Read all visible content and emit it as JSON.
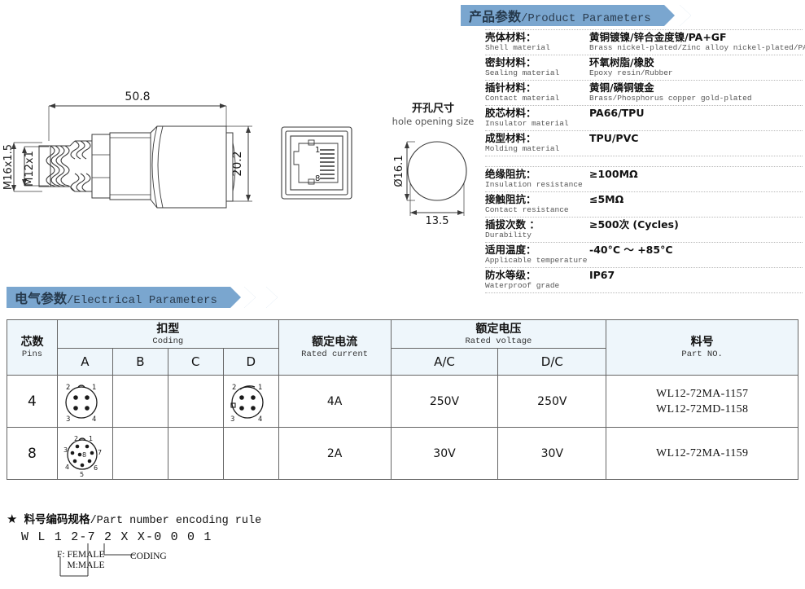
{
  "sections": {
    "product_parameters": {
      "title_cn": "产品参数",
      "title_sep": "/",
      "title_en": "Product Parameters"
    },
    "electrical_parameters": {
      "title_cn": "电气参数",
      "title_sep": "/",
      "title_en": "Electrical Parameters"
    }
  },
  "product_specs": [
    {
      "label_cn": "壳体材料：",
      "label_en": "Shell material",
      "value_cn": "黄铜镀镍/锌合金度镍/PA+GF",
      "value_en": "Brass nickel-plated/Zinc alloy nickel-plated/PA-GF"
    },
    {
      "label_cn": "密封材料：",
      "label_en": "Sealing material",
      "value_cn": "环氧树脂/橡胶",
      "value_en": "Epoxy resin/Rubber"
    },
    {
      "label_cn": "插针材料：",
      "label_en": "Contact material",
      "value_cn": "黄铜/磷铜镀金",
      "value_en": "Brass/Phosphorus copper gold-plated"
    },
    {
      "label_cn": "胶芯材料：",
      "label_en": "Insulator material",
      "value_cn": "PA66/TPU",
      "value_en": ""
    },
    {
      "label_cn": "成型材料：",
      "label_en": "Molding material",
      "value_cn": "TPU/PVC",
      "value_en": ""
    }
  ],
  "product_specs_2": [
    {
      "label_cn": "绝缘阻抗：",
      "label_en": "Insulation resistance",
      "value_cn": "≥100MΩ",
      "value_en": ""
    },
    {
      "label_cn": "接触阻抗：",
      "label_en": "Contact resistance",
      "value_cn": "≤5MΩ",
      "value_en": ""
    },
    {
      "label_cn": "插拔次数 ：",
      "label_en": "Durability",
      "value_cn": "≥500次 (Cycles)",
      "value_en": ""
    },
    {
      "label_cn": "适用温度：",
      "label_en": "Applicable temperature",
      "value_cn": "-40°C ～ +85°C",
      "value_en": ""
    },
    {
      "label_cn": "防水等级：",
      "label_en": "Waterproof grade",
      "value_cn": "IP67",
      "value_en": ""
    }
  ],
  "drawings": {
    "length": "50.8",
    "height": "20.2",
    "thread_outer": "M16x1.5",
    "thread_inner": "M12x1",
    "hole_title_cn": "开孔尺寸",
    "hole_title_en": "hole opening size",
    "hole_diameter": "Ø16.1",
    "hole_width": "13.5",
    "rj45_pin_top": "1",
    "rj45_pin_bottom": "8"
  },
  "table": {
    "headers": {
      "pins_cn": "芯数",
      "pins_en": "Pins",
      "coding_cn": "扣型",
      "coding_en": "Coding",
      "coding_cols": [
        "A",
        "B",
        "C",
        "D"
      ],
      "current_cn": "额定电流",
      "current_en": "Rated current",
      "voltage_cn": "额定电压",
      "voltage_en": "Rated voltage",
      "voltage_cols": [
        "A/C",
        "D/C"
      ],
      "partno_cn": "料号",
      "partno_en": "Part NO."
    },
    "rows": [
      {
        "pins": "4",
        "coding": {
          "A": "pinout-4",
          "B": "",
          "C": "",
          "D": "pinout-4d"
        },
        "current": "4A",
        "voltage_ac": "250V",
        "voltage_dc": "250V",
        "part_numbers": [
          "WL12-72MA-1157",
          "WL12-72MD-1158"
        ]
      },
      {
        "pins": "8",
        "coding": {
          "A": "pinout-8",
          "B": "",
          "C": "",
          "D": ""
        },
        "current": "2A",
        "voltage_ac": "30V",
        "voltage_dc": "30V",
        "part_numbers": [
          "WL12-72MA-1159"
        ]
      }
    ]
  },
  "encoding_rule": {
    "star": "★",
    "title_cn": "料号编码规格",
    "title_sep": "/",
    "title_en": "Part number encoding rule",
    "pattern": "W L 1 2-7 2 X X-0 0 0 1",
    "note_female": "F: FEMALE",
    "note_male": "M:MALE",
    "note_coding": "CODING"
  },
  "colors": {
    "banner": "#7aa6cf",
    "table_header_bg": "#eef6fb",
    "table_border": "#666666"
  }
}
